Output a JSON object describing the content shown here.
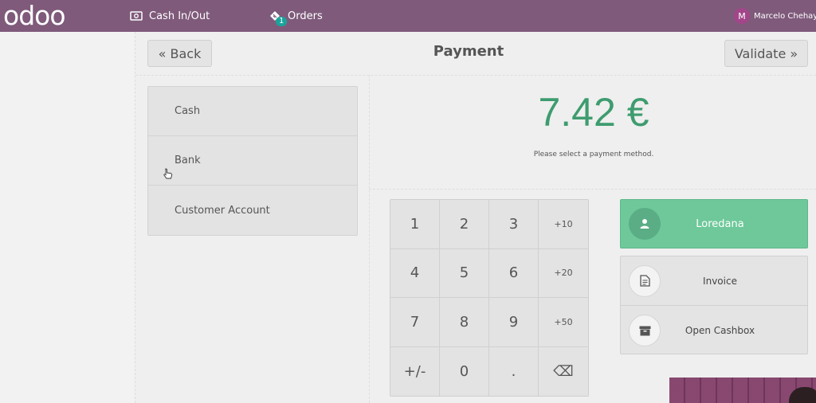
{
  "app": {
    "logo": "odoo"
  },
  "topbar": {
    "cash_in_out": "Cash In/Out",
    "orders": "Orders",
    "orders_count": "1",
    "user_initial": "M",
    "user_name": "Marcelo Chehayeb"
  },
  "header": {
    "back_label": "« Back",
    "title": "Payment",
    "validate_label": "Validate »"
  },
  "payment_methods": [
    "Cash",
    "Bank",
    "Customer Account"
  ],
  "summary": {
    "amount": "7.42 €",
    "hint": "Please select a payment method."
  },
  "numpad": {
    "keys": [
      "1",
      "2",
      "3",
      "+10",
      "4",
      "5",
      "6",
      "+20",
      "7",
      "8",
      "9",
      "+50",
      "+/-",
      "0",
      ".",
      "⌫"
    ]
  },
  "customer": {
    "name": "Loredana"
  },
  "actions": {
    "invoice": "Invoice",
    "open_cashbox": "Open Cashbox"
  },
  "colors": {
    "topbar": "#7f5a7b",
    "amount": "#3e9c6f",
    "customer_bg": "#6ec89a"
  }
}
